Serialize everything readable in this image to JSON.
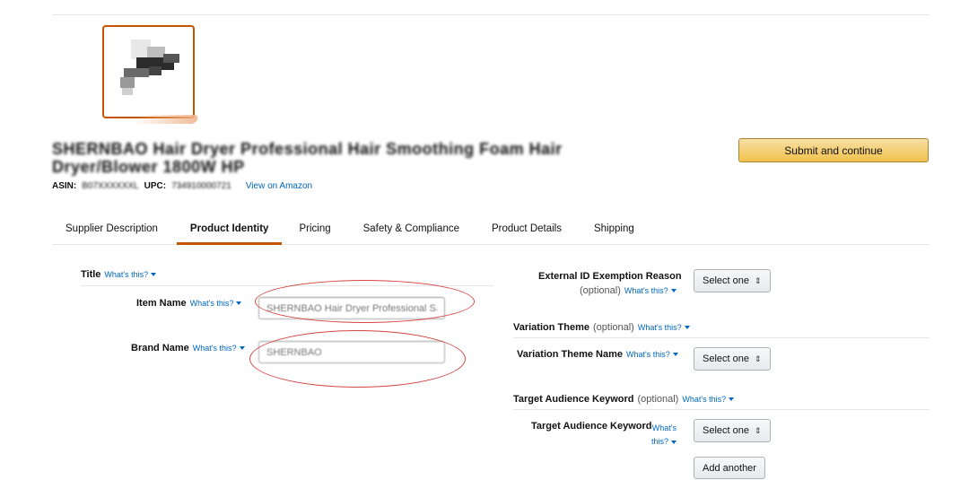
{
  "header": {
    "product_title": "SHERNBAO Hair Dryer Professional Hair Smoothing Foam Hair Dryer/Blower 1800W HP",
    "asin_label": "ASIN:",
    "asin_value": "B07XXXXXXL",
    "upc_label": "UPC:",
    "upc_value": "734910000721",
    "view_link": "View on Amazon",
    "submit_label": "Submit and continue"
  },
  "tabs": [
    {
      "label": "Supplier Description",
      "active": false
    },
    {
      "label": "Product Identity",
      "active": true
    },
    {
      "label": "Pricing",
      "active": false
    },
    {
      "label": "Safety & Compliance",
      "active": false
    },
    {
      "label": "Product Details",
      "active": false
    },
    {
      "label": "Shipping",
      "active": false
    }
  ],
  "left": {
    "title_label": "Title",
    "whats_this": "What's this?",
    "item_name_label": "Item Name",
    "item_name_value": "SHERNBAO Hair Dryer Professional Salon",
    "brand_name_label": "Brand Name",
    "brand_name_value": "SHERNBAO"
  },
  "right": {
    "exemption_label": "External ID Exemption Reason",
    "exemption_optional": "(optional)",
    "select_one": "Select one",
    "select_arrows": "⇕",
    "variation_theme_label": "Variation Theme",
    "optional": "(optional)",
    "variation_theme_name_label": "Variation Theme Name",
    "target_audience_keyword_label": "Target Audience Keyword",
    "target_audience_keyword_field_label": "Target Audience Keyword",
    "add_another": "Add another"
  },
  "colors": {
    "accent": "#c45500",
    "link": "#0066c0",
    "submit_bg": "#f0c14b",
    "annotation": "#d64545"
  }
}
